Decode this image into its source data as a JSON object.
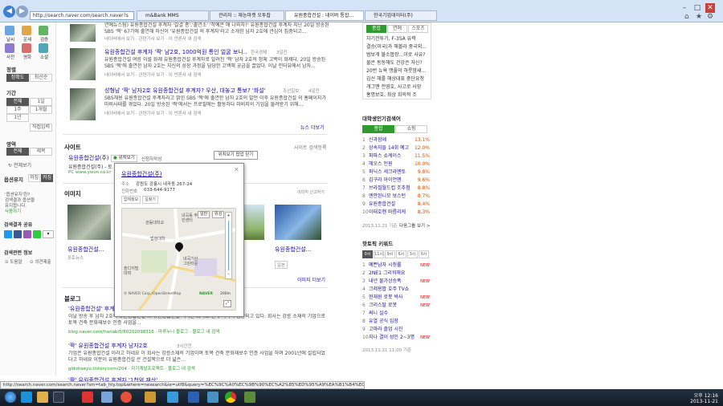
{
  "browser": {
    "address": "http://search.naver.com/search.naver?s",
    "tabs": [
      {
        "label": "m&Bank MMS",
        "active": false
      },
      {
        "label": "관리자 :: 재능마켓 오투잡",
        "active": false
      },
      {
        "label": "유원종합건설 : 네이버 통합…",
        "active": true
      },
      {
        "label": "한국기업데이터(주)",
        "active": false
      }
    ],
    "accent": "#3d7fd1"
  },
  "left_panel": {
    "icons": [
      "날씨",
      "운세",
      "검증",
      "사전",
      "영화",
      "소셜"
    ],
    "sort_title": "정렬",
    "sort_options": [
      "정확도",
      "최신순"
    ],
    "period_title": "기간",
    "period_options": [
      "전체",
      "1일",
      "1주",
      "1개월",
      "1년"
    ],
    "period_custom": "직접입력",
    "area_title": "영역",
    "area_options": [
      "전체",
      "제목"
    ],
    "area_reset": "전체보기",
    "option_title": "옵션유지",
    "option_values": [
      "꺼짐",
      "켜짐"
    ],
    "promo_lines": [
      "'옵션유지'란?",
      "검색결과 옵션을",
      "유지합니다."
    ],
    "promo_link": "사용하기",
    "share_title": "검색결과 공유",
    "related_title": "검색관련 정보",
    "related_items": [
      "도움말",
      "의견제출"
    ]
  },
  "results": [
    {
      "title": "",
      "snippet": "연예뉴스팀) 유원종합건설 후계자 '갈결 종','출연소' '작예은 애 나와자?' 유원종합건설 후계자 지난 20일 방송된 SBS '짝' 67기에 출연해 자신이 '유원종합건설 의 후계자'라고 소개한 남자 2호에 관심이 집중되고...",
      "meta": "네이버에서 보기 · 관련기사 보기 · 이 언론사 내 검색"
    },
    {
      "title": "유원종합건설 후계자 '짝' 남2호, 1000억원 통인 얼굴 보니…",
      "source": "한국경제",
      "time": "3일전",
      "snippet": "유원종합건설 여름 이를 화제 유원종합건설 후계자로 알려진 '짝' 남자 2호의 정체 고백이 화제다. 20일 방송된 SBS '짝'에 출연한 남자 2호는 자신의 성장 과정을 담당한 고백해 궁금을 끌었다. 이날 인터뷰에서 남자...",
      "meta": "네이버에서 보기 · 관련기사 보기 · 이 언론사 내 검색"
    },
    {
      "title": "성형남 '짝' 남자2호 유원종합건설 후계자? 우산, 대놓고 통보? '화설'",
      "source": "조선일보",
      "time": "4일전",
      "snippet": "SBS채용 유원종합건설 후계자라고 밝힌 SBS '짝'에 출연한 남자 2호의 발언 이후 유원종합건설 의 홈페이지가 마비사태를 겪었다. 20일 방송된 '짝'에서는 프로필에는 활동하다 마비지의 기업을 물려받기 위해...",
      "meta": "네이버에서 보기 · 관련기사 보기 · 이 언론사 내 검색"
    }
  ],
  "news_more": "뉴스 더보기",
  "site_section": {
    "title": "사이트",
    "register": "사이트 검색등록",
    "result_title": "유원종합건설(주)",
    "result_buttons": [
      "위치보기",
      "신청자작성"
    ],
    "result_desc": "유원종합건설(주) - 토",
    "result_url": "PC www.ywon.co.kr",
    "popup_close": "위치보기 팝업 닫기"
  },
  "popup": {
    "title": "유원종합건설(주)",
    "address_label": "주소",
    "address": "강원도 강릉시 내곡동 267-24",
    "phone_label": "전화번호",
    "phone": "033-644-9177",
    "buttons": [
      "업체정보",
      "길찾기"
    ],
    "map_types": [
      "일반",
      "위성"
    ],
    "map_places": [
      "관동대학교",
      "내곡동 주민센터",
      "법정대학",
      "내곡기산 그린타운",
      "솔디지털 대학"
    ],
    "map_credit": "© NAVER Corp./OpenStreetMap",
    "map_brand": "NAVER",
    "map_scale": "200m"
  },
  "images": {
    "title": "이미지",
    "report": "이미지 신고하기",
    "items": [
      {
        "caption": "유원종합건설...",
        "sub": "포토뉴스"
      },
      {
        "caption": "",
        "sub": ""
      },
      {
        "caption": "유원종합건설...",
        "sub": "일본"
      },
      {
        "caption": "유원종합건설...",
        "sub": "일본"
      }
    ],
    "more": "이미지 더보기"
  },
  "blog": {
    "title": "블로그",
    "items": [
      {
        "title": "'유원종합건설' 후계자 '짝' 남자",
        "snippet": "이날 방송 후 남자 2호의 유원종합건설 ... 유원종합건설 이라는 회사로 인해 이목이 집중되고 있다. 회사는 강릉 소재의 기업으로 토목 건축 문화재보수 인증 사업을...",
        "url": "blog.naver.com/hanabi5/80202098316 · 마루누나 블로그 · 블로그 내 검색"
      },
      {
        "title": "'짝' 유원종합건설 후계자 남자2호",
        "time": "3시간전",
        "snippet": "기업은 유원종합건설 이라고 하네요 이 회사는 강릉소재의 기업이며 토목 건축 문화재보수 인증 사업을 하며 2001년에 설립되었다고 하네요 이분이 유원종합건설 은 건설쪽으로 더 넓은...",
        "url": "gidohaeyo.tistory.com/204 · 자기계발프로젝트 · 블로그 내 검색"
      },
      {
        "title": "'짝' 유원종합건설 후계자 '1천억 재산'",
        "time": "4시간전",
        "snippet": "",
        "url": ""
      }
    ]
  },
  "right_panel": {
    "hot_tabs": [
      "종합",
      "연예",
      "스포츠"
    ],
    "hot_items": [
      "차기전투기, F-35A 유력",
      "결승(미국)과 해볼라 중국외...",
      "범보게 불소봅캉...이로 사유?",
      "물은 동동해도 건강은 자신?",
      "20번 뉴욕 맹풀의 하룻밤새...",
      "김선 해를 해상대표 중단요청",
      "개그맨 전영호, 사고로 사망",
      "홍명보호, 최상 회의적 조"
    ],
    "univ_title": "대학생인기검색어",
    "univ_tabs": [
      "종합",
      "쇼핑"
    ],
    "univ_items": [
      {
        "name": "신과함께",
        "value": "13.1%"
      },
      {
        "name": "상속자들 14회 예고",
        "value": "12.0%"
      },
      {
        "name": "파파스 쇼케이스",
        "value": "11.5%"
      },
      {
        "name": "헤오스 인원",
        "value": "10.0%"
      },
      {
        "name": "파닉스 세크라멘토",
        "value": "9.8%"
      },
      {
        "name": "김구라 아이언맨",
        "value": "9.6%"
      },
      {
        "name": "브라질월드컵 조추첨",
        "value": "8.8%"
      },
      {
        "name": "엔안된니모 보스턴",
        "value": "8.7%"
      },
      {
        "name": "유원종합건설",
        "value": "8.4%"
      },
      {
        "name": "이태호헨 마름리케",
        "value": "8.3%"
      }
    ],
    "univ_time": "2013.11.21 기준",
    "univ_next": "다음그룹 보기 >",
    "kw_title": "핫토픽 키워드",
    "kw_tabs": [
      "0시",
      "11시",
      "9시",
      "6시",
      "3시",
      "0시"
    ],
    "kw_items": [
      {
        "name": "예쁜남자 시청률",
        "new": true
      },
      {
        "name": "2NE1 그리워해요",
        "new": false
      },
      {
        "name": "내년 물가상승폭",
        "new": true
      },
      {
        "name": "크레용팝 호주 TV쇼",
        "new": false
      },
      {
        "name": "현재원 로봇 박사",
        "new": true
      },
      {
        "name": "크리스탈 로봇",
        "new": true
      },
      {
        "name": "써니 실수",
        "new": false
      },
      {
        "name": "유열 공식 입장",
        "new": false
      },
      {
        "name": "고마라 졸업 시진",
        "new": false
      },
      {
        "name": "지나 결이 성인 2~3명",
        "new": true
      }
    ],
    "kw_time": "2013.11.21 11:00 기준",
    "new_label": "NEW"
  },
  "status_url": "http://search.naver.com/search.naver?sm=tab_hty.top&where=nexearch&ie=utf8&query=%EC%9C%A0%EC%9B%90%EC%A2%85%ED%95%A9%EA%B1%B4%EC%84%A4&x...",
  "taskbar": {
    "time": "오후 12:16",
    "date": "2013-11-21"
  }
}
